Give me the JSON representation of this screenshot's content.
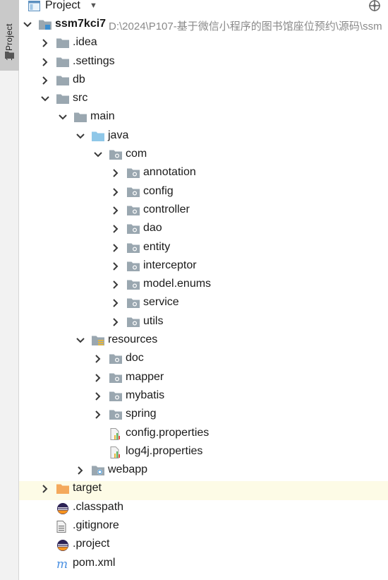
{
  "sidebar_tab": {
    "label": "1: Project"
  },
  "header": {
    "title": "Project"
  },
  "tree": [
    {
      "label": "ssm7kci7",
      "bold": true,
      "path": "D:\\2024\\P107-基于微信小程序的图书馆座位预约\\源码\\ssm",
      "depth": 0,
      "arrow": "down",
      "icon": "module"
    },
    {
      "label": ".idea",
      "depth": 1,
      "arrow": "right",
      "icon": "folder-gray"
    },
    {
      "label": ".settings",
      "depth": 1,
      "arrow": "right",
      "icon": "folder-gray"
    },
    {
      "label": "db",
      "depth": 1,
      "arrow": "right",
      "icon": "folder-gray"
    },
    {
      "label": "src",
      "depth": 1,
      "arrow": "down",
      "icon": "folder-gray"
    },
    {
      "label": "main",
      "depth": 2,
      "arrow": "down",
      "icon": "folder-gray"
    },
    {
      "label": "java",
      "depth": 3,
      "arrow": "down",
      "icon": "folder-blue"
    },
    {
      "label": "com",
      "depth": 4,
      "arrow": "down",
      "icon": "package"
    },
    {
      "label": "annotation",
      "depth": 5,
      "arrow": "right",
      "icon": "package"
    },
    {
      "label": "config",
      "depth": 5,
      "arrow": "right",
      "icon": "package"
    },
    {
      "label": "controller",
      "depth": 5,
      "arrow": "right",
      "icon": "package"
    },
    {
      "label": "dao",
      "depth": 5,
      "arrow": "right",
      "icon": "package"
    },
    {
      "label": "entity",
      "depth": 5,
      "arrow": "right",
      "icon": "package"
    },
    {
      "label": "interceptor",
      "depth": 5,
      "arrow": "right",
      "icon": "package"
    },
    {
      "label": "model.enums",
      "depth": 5,
      "arrow": "right",
      "icon": "package"
    },
    {
      "label": "service",
      "depth": 5,
      "arrow": "right",
      "icon": "package"
    },
    {
      "label": "utils",
      "depth": 5,
      "arrow": "right",
      "icon": "package"
    },
    {
      "label": "resources",
      "depth": 3,
      "arrow": "down",
      "icon": "resources"
    },
    {
      "label": "doc",
      "depth": 4,
      "arrow": "right",
      "icon": "package"
    },
    {
      "label": "mapper",
      "depth": 4,
      "arrow": "right",
      "icon": "package"
    },
    {
      "label": "mybatis",
      "depth": 4,
      "arrow": "right",
      "icon": "package"
    },
    {
      "label": "spring",
      "depth": 4,
      "arrow": "right",
      "icon": "package"
    },
    {
      "label": "config.properties",
      "depth": 4,
      "arrow": "none",
      "icon": "properties"
    },
    {
      "label": "log4j.properties",
      "depth": 4,
      "arrow": "none",
      "icon": "properties"
    },
    {
      "label": "webapp",
      "depth": 3,
      "arrow": "right",
      "icon": "web"
    },
    {
      "label": "target",
      "depth": 1,
      "arrow": "right",
      "icon": "folder-orange",
      "highlight": true
    },
    {
      "label": ".classpath",
      "depth": 1,
      "arrow": "none",
      "icon": "eclipse"
    },
    {
      "label": ".gitignore",
      "depth": 1,
      "arrow": "none",
      "icon": "text-file"
    },
    {
      "label": ".project",
      "depth": 1,
      "arrow": "none",
      "icon": "eclipse"
    },
    {
      "label": "pom.xml",
      "depth": 1,
      "arrow": "none",
      "icon": "maven"
    }
  ],
  "colors": {
    "folder_gray": "#9aa7b0",
    "folder_blue": "#8fc7e8",
    "folder_orange": "#f4a95c",
    "maven_blue": "#4a90e2",
    "eclipse_navy": "#2c2255",
    "eclipse_orange": "#f7941e",
    "highlight_row": "#fdfbe6"
  }
}
